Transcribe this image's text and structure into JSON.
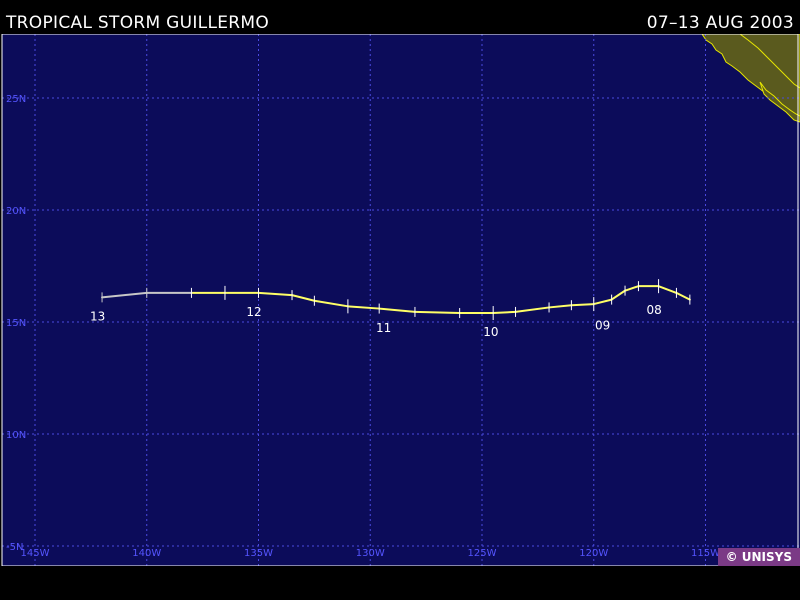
{
  "header": {
    "title": "TROPICAL STORM GUILLERMO",
    "date_range": "07–13 AUG 2003"
  },
  "credit": "© UNISYS",
  "colors": {
    "ocean": "#0c0c5a",
    "grid": "#4a4ae0",
    "label": "#5555ff",
    "land": "#5a5a1e",
    "coast": "#e6e600",
    "track_storm": "#ffff66",
    "track_depression": "#c8c8c8"
  },
  "map": {
    "lon_range": [
      -146,
      -111
    ],
    "lat_range": [
      -5,
      28
    ],
    "lon_grid": [
      -145,
      -140,
      -135,
      -130,
      -125,
      -120,
      -115
    ],
    "lat_grid": [
      -5,
      10,
      15,
      20,
      25
    ],
    "lon_labels": [
      "145W",
      "140W",
      "135W",
      "130W",
      "125W",
      "120W",
      "115W"
    ],
    "lat_labels": [
      "-5N",
      "10N",
      "15N",
      "20N",
      "25N"
    ]
  },
  "track": {
    "points": [
      {
        "lon": -115.7,
        "lat": 16.0,
        "class": "storm"
      },
      {
        "lon": -116.3,
        "lat": 16.3,
        "class": "storm"
      },
      {
        "lon": -117.1,
        "lat": 16.6,
        "class": "storm"
      },
      {
        "lon": -118.0,
        "lat": 16.6,
        "class": "storm"
      },
      {
        "lon": -118.6,
        "lat": 16.4,
        "class": "storm"
      },
      {
        "lon": -119.2,
        "lat": 16.0,
        "class": "storm"
      },
      {
        "lon": -120.0,
        "lat": 15.8,
        "class": "storm"
      },
      {
        "lon": -121.0,
        "lat": 15.75,
        "class": "storm"
      },
      {
        "lon": -122.0,
        "lat": 15.65,
        "class": "storm"
      },
      {
        "lon": -123.5,
        "lat": 15.45,
        "class": "storm"
      },
      {
        "lon": -124.5,
        "lat": 15.4,
        "class": "storm"
      },
      {
        "lon": -126.0,
        "lat": 15.4,
        "class": "storm"
      },
      {
        "lon": -128.0,
        "lat": 15.45,
        "class": "storm"
      },
      {
        "lon": -129.6,
        "lat": 15.6,
        "class": "storm"
      },
      {
        "lon": -131.0,
        "lat": 15.7,
        "class": "storm"
      },
      {
        "lon": -132.5,
        "lat": 15.95,
        "class": "storm"
      },
      {
        "lon": -133.5,
        "lat": 16.2,
        "class": "storm"
      },
      {
        "lon": -135.0,
        "lat": 16.3,
        "class": "storm"
      },
      {
        "lon": -136.5,
        "lat": 16.3,
        "class": "storm"
      },
      {
        "lon": -138.0,
        "lat": 16.3,
        "class": "storm"
      },
      {
        "lon": -140.0,
        "lat": 16.3,
        "class": "depression"
      },
      {
        "lon": -142.0,
        "lat": 16.1,
        "class": "depression"
      }
    ],
    "day_labels": [
      {
        "text": "08",
        "lon": -117.3,
        "lat": 15.9
      },
      {
        "text": "09",
        "lon": -119.6,
        "lat": 15.2
      },
      {
        "text": "10",
        "lon": -124.6,
        "lat": 14.9
      },
      {
        "text": "11",
        "lon": -129.4,
        "lat": 15.1
      },
      {
        "text": "12",
        "lon": -135.2,
        "lat": 15.8
      },
      {
        "text": "13",
        "lon": -142.2,
        "lat": 15.6
      }
    ]
  }
}
